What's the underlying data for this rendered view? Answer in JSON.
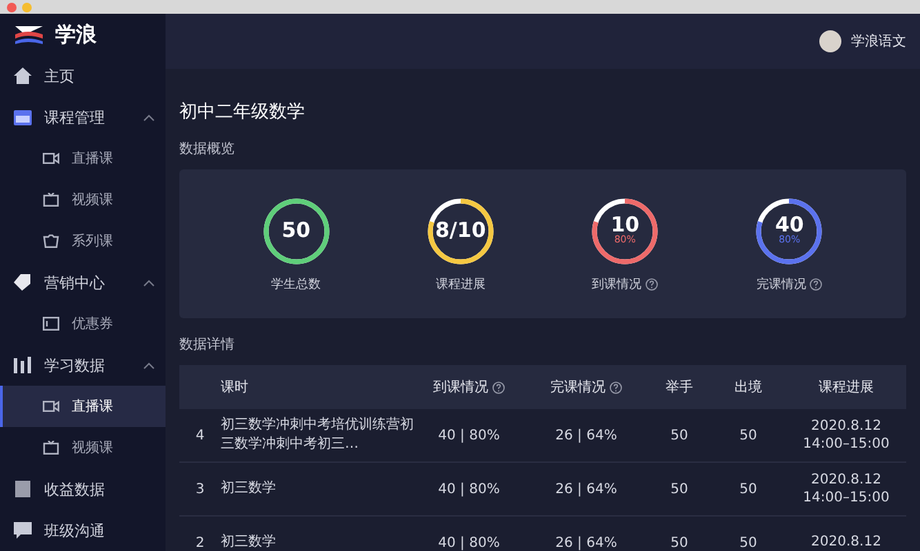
{
  "app": {
    "name": "学浪"
  },
  "sidebar": {
    "items": [
      {
        "label": "主页",
        "selected": false
      },
      {
        "label": "课程管理",
        "expanded": true,
        "children": [
          {
            "label": "直播课",
            "selected": false
          },
          {
            "label": "视频课",
            "selected": false
          },
          {
            "label": "系列课",
            "selected": false
          }
        ]
      },
      {
        "label": "营销中心",
        "expanded": true,
        "children": [
          {
            "label": "优惠券",
            "selected": false
          }
        ]
      },
      {
        "label": "学习数据",
        "expanded": true,
        "children": [
          {
            "label": "直播课",
            "selected": true
          },
          {
            "label": "视频课",
            "selected": false
          }
        ]
      },
      {
        "label": "收益数据",
        "selected": false
      },
      {
        "label": "班级沟通",
        "selected": false
      }
    ]
  },
  "header": {
    "user": "学浪语文"
  },
  "page_title": "初中二年级数学",
  "overview": {
    "title": "数据概览",
    "stats": [
      {
        "value": "50",
        "label": "学生总数",
        "help": false,
        "level": 1,
        "color": "#5fce7a"
      },
      {
        "value": "8/10",
        "label": "课程进展",
        "help": false,
        "level": 0.8,
        "color": "#f5c842"
      },
      {
        "value": "10",
        "sub": "80%",
        "label": "到课情况",
        "help": true,
        "level": 0.8,
        "color": "#ee6a6a"
      },
      {
        "value": "40",
        "sub": "80%",
        "label": "完课情况",
        "help": true,
        "level": 0.8,
        "color": "#5b72ee"
      }
    ]
  },
  "details": {
    "title": "数据详情",
    "columns": [
      {
        "label": "课时",
        "help": false
      },
      {
        "label": "到课情况",
        "help": true
      },
      {
        "label": "完课情况",
        "help": true
      },
      {
        "label": "举手",
        "help": false
      },
      {
        "label": "出境",
        "help": false
      },
      {
        "label": "课程进展",
        "help": false
      }
    ],
    "rows": [
      {
        "index": "4",
        "lesson": "初三数学冲刺中考培优训练营初三数学冲刺中考初三…",
        "attendance": "40 | 80%",
        "completion": "26 | 64%",
        "hands": "50",
        "oncam": "50",
        "date": "2020.8.12",
        "time": "14:00–15:00"
      },
      {
        "index": "3",
        "lesson": "初三数学",
        "attendance": "40 | 80%",
        "completion": "26 | 64%",
        "hands": "50",
        "oncam": "50",
        "date": "2020.8.12",
        "time": "14:00–15:00"
      },
      {
        "index": "2",
        "lesson": "初三数学",
        "attendance": "40 | 80%",
        "completion": "26 | 64%",
        "hands": "50",
        "oncam": "50",
        "date": "2020.8.12"
      }
    ]
  }
}
